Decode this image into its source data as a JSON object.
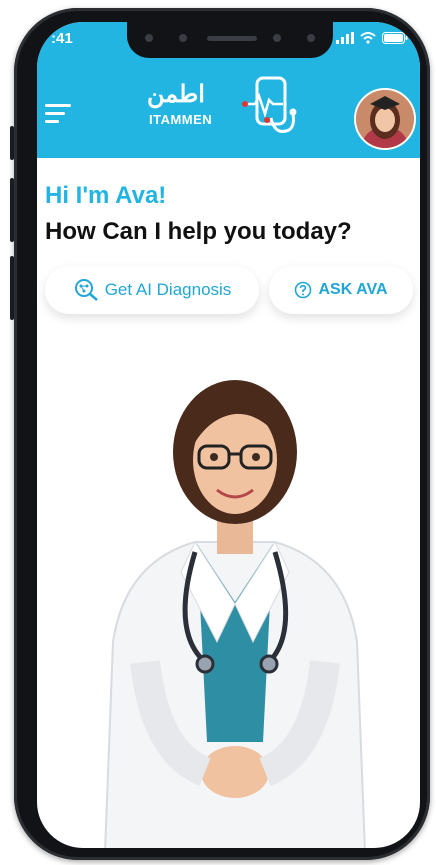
{
  "status_bar": {
    "time": ":41"
  },
  "header": {
    "logo_arabic": "اطمن",
    "logo_english": "ITAMMEN"
  },
  "greeting": {
    "name_line": "Hi I'm Ava!",
    "question": "How Can I help you today?"
  },
  "actions": {
    "diagnosis_label": "Get AI Diagnosis",
    "ask_label": "ASK AVA"
  },
  "colors": {
    "brand": "#22b5e1",
    "text_dark": "#111111",
    "scrubs": "#2e8fa4"
  },
  "icons": {
    "menu": "menu-icon",
    "diagnosis": "ai-diagnosis-icon",
    "ask": "help-circle-icon",
    "logo_mark": "phone-heartbeat-icon"
  }
}
